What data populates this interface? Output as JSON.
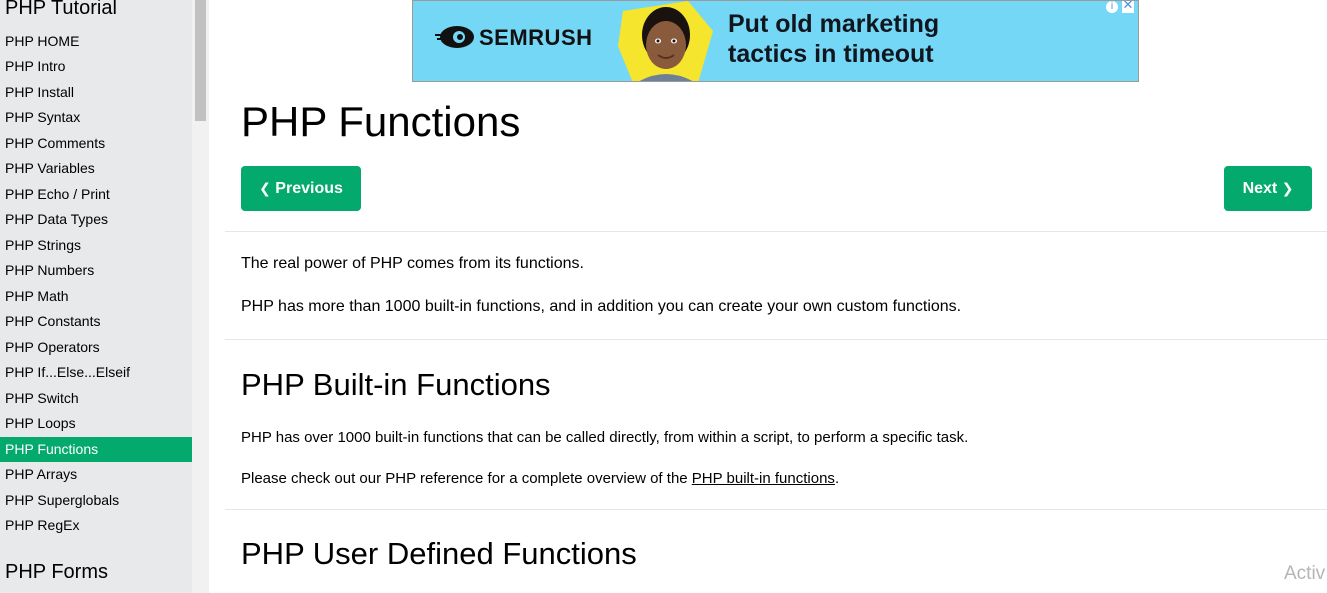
{
  "sidebar": {
    "section_title": "PHP Tutorial",
    "items": [
      {
        "label": "PHP HOME"
      },
      {
        "label": "PHP Intro"
      },
      {
        "label": "PHP Install"
      },
      {
        "label": "PHP Syntax"
      },
      {
        "label": "PHP Comments"
      },
      {
        "label": "PHP Variables"
      },
      {
        "label": "PHP Echo / Print"
      },
      {
        "label": "PHP Data Types"
      },
      {
        "label": "PHP Strings"
      },
      {
        "label": "PHP Numbers"
      },
      {
        "label": "PHP Math"
      },
      {
        "label": "PHP Constants"
      },
      {
        "label": "PHP Operators"
      },
      {
        "label": "PHP If...Else...Elseif"
      },
      {
        "label": "PHP Switch"
      },
      {
        "label": "PHP Loops"
      },
      {
        "label": "PHP Functions"
      },
      {
        "label": "PHP Arrays"
      },
      {
        "label": "PHP Superglobals"
      },
      {
        "label": "PHP RegEx"
      }
    ],
    "active_item": "PHP Functions",
    "next_section_title": "PHP Forms"
  },
  "ad": {
    "brand": "SEMRUSH",
    "headline_line1": "Put old marketing",
    "headline_line2": "tactics in timeout",
    "info_glyph": "i",
    "close_glyph": "✕"
  },
  "main": {
    "title": "PHP Functions",
    "prev_label": "Previous",
    "next_label": "Next",
    "intro_p1": "The real power of PHP comes from its functions.",
    "intro_p2": "PHP has more than 1000 built-in functions, and in addition you can create your own custom functions.",
    "builtin_heading": "PHP Built-in Functions",
    "builtin_p1": "PHP has over 1000 built-in functions that can be called directly, from within a script, to perform a specific task.",
    "builtin_p2_before": "Please check out our PHP reference for a complete overview of the ",
    "builtin_link": "PHP built-in functions",
    "builtin_p2_after": ".",
    "user_heading": "PHP User Defined Functions"
  },
  "watermark": "Activ",
  "colors": {
    "accent_green": "#04aa6d",
    "sidebar_bg": "#e7e9eb",
    "ad_bg": "#75d7f6"
  }
}
